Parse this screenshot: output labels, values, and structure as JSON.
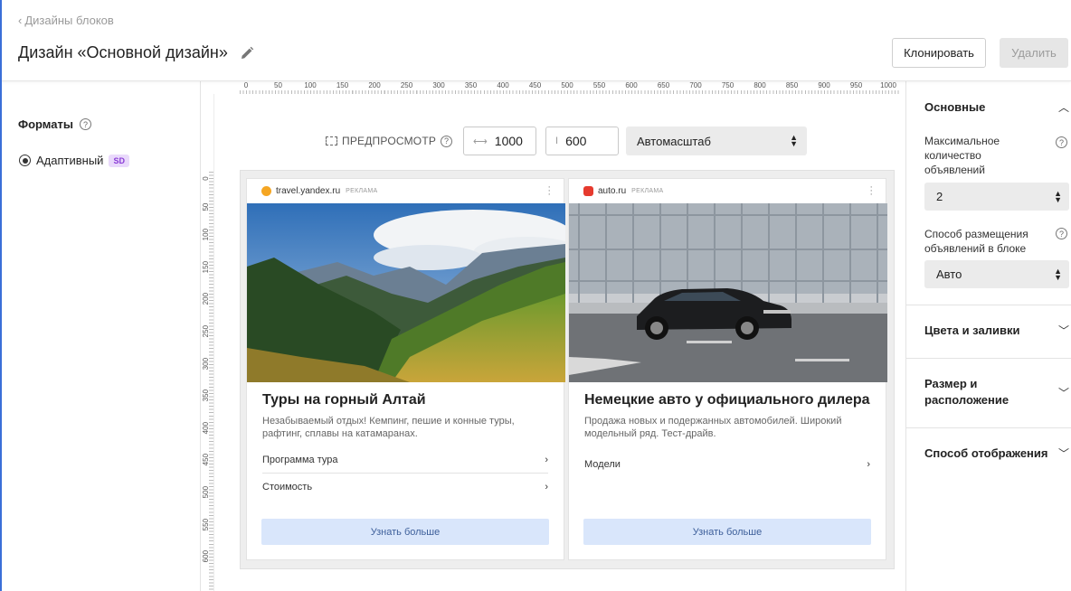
{
  "header": {
    "breadcrumb": "Дизайны блоков",
    "title": "Дизайн «Основной дизайн»",
    "clone_label": "Клонировать",
    "delete_label": "Удалить"
  },
  "left_panel": {
    "formats_title": "Форматы",
    "format_item": "Адаптивный",
    "format_badge": "SD"
  },
  "rulers": {
    "horizontal": [
      "0",
      "50",
      "100",
      "150",
      "200",
      "250",
      "300",
      "350",
      "400",
      "450",
      "500",
      "550",
      "600",
      "650",
      "700",
      "750",
      "800",
      "850",
      "900",
      "950",
      "1000"
    ],
    "vertical": [
      "0",
      "50",
      "100",
      "150",
      "200",
      "250",
      "300",
      "350",
      "400",
      "450",
      "500",
      "550",
      "600"
    ]
  },
  "preview_bar": {
    "label": "ПРЕДПРОСМОТР",
    "width_value": "1000",
    "height_value": "600",
    "scale_option": "Автомасштаб"
  },
  "ads": [
    {
      "domain": "travel.yandex.ru",
      "tag": "РЕКЛАМА",
      "title": "Туры на горный Алтай",
      "description": "Незабываемый отдых! Кемпинг, пешие и конные туры, рафтинг, сплавы на катамаранах.",
      "links": [
        "Программа тура",
        "Стоимость"
      ],
      "button": "Узнать больше",
      "favicon_color": "#f5a623"
    },
    {
      "domain": "auto.ru",
      "tag": "РЕКЛАМА",
      "title": "Немецкие авто у официального дилера",
      "description": "Продажа новых и подержанных автомобилей. Широкий модельный ряд. Тест-драйв.",
      "links": [
        "Модели"
      ],
      "button": "Узнать больше",
      "favicon_color": "#e63a2e"
    }
  ],
  "right_panel": {
    "basic_title": "Основные",
    "max_ads_label": "Максимальное количество объявлений",
    "max_ads_value": "2",
    "placement_label": "Способ размещения объявлений в блоке",
    "placement_value": "Авто",
    "colors_title": "Цвета и заливки",
    "size_title": "Размер и расположение",
    "display_title": "Способ отображения"
  },
  "colors": {
    "accent_button_bg": "#d9e6fb",
    "badge_bg": "#e9d9fb",
    "badge_text": "#8a3bd6"
  }
}
